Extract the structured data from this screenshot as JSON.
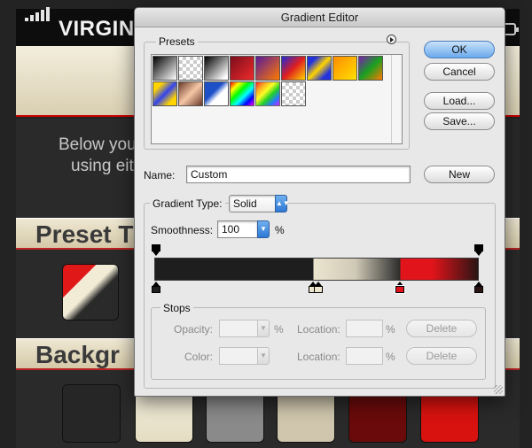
{
  "background_app": {
    "carrier": "VIRGIN",
    "intro_line1": "Below you",
    "intro_line2": "using eit",
    "section_preset": "Preset T",
    "section_background": "Backgr"
  },
  "dialog": {
    "title": "Gradient Editor",
    "presets_label": "Presets",
    "presets_menu_icon": "circle-arrow-icon",
    "name_label": "Name:",
    "name_value": "Custom",
    "buttons": {
      "ok": "OK",
      "cancel": "Cancel",
      "load": "Load...",
      "save": "Save...",
      "new": "New"
    },
    "gradient_type_label": "Gradient Type:",
    "gradient_type_value": "Solid",
    "smoothness_label": "Smoothness:",
    "smoothness_value": "100",
    "percent": "%",
    "stops": {
      "label": "Stops",
      "opacity_label": "Opacity:",
      "color_label": "Color:",
      "location_label": "Location:",
      "delete_label": "Delete",
      "percent": "%"
    }
  },
  "colors": {
    "accent_blue": "#6aa9ec",
    "dark_stop": "#1e1e1e",
    "cream_stop": "#ece6cf",
    "red_stop": "#e0141a"
  }
}
